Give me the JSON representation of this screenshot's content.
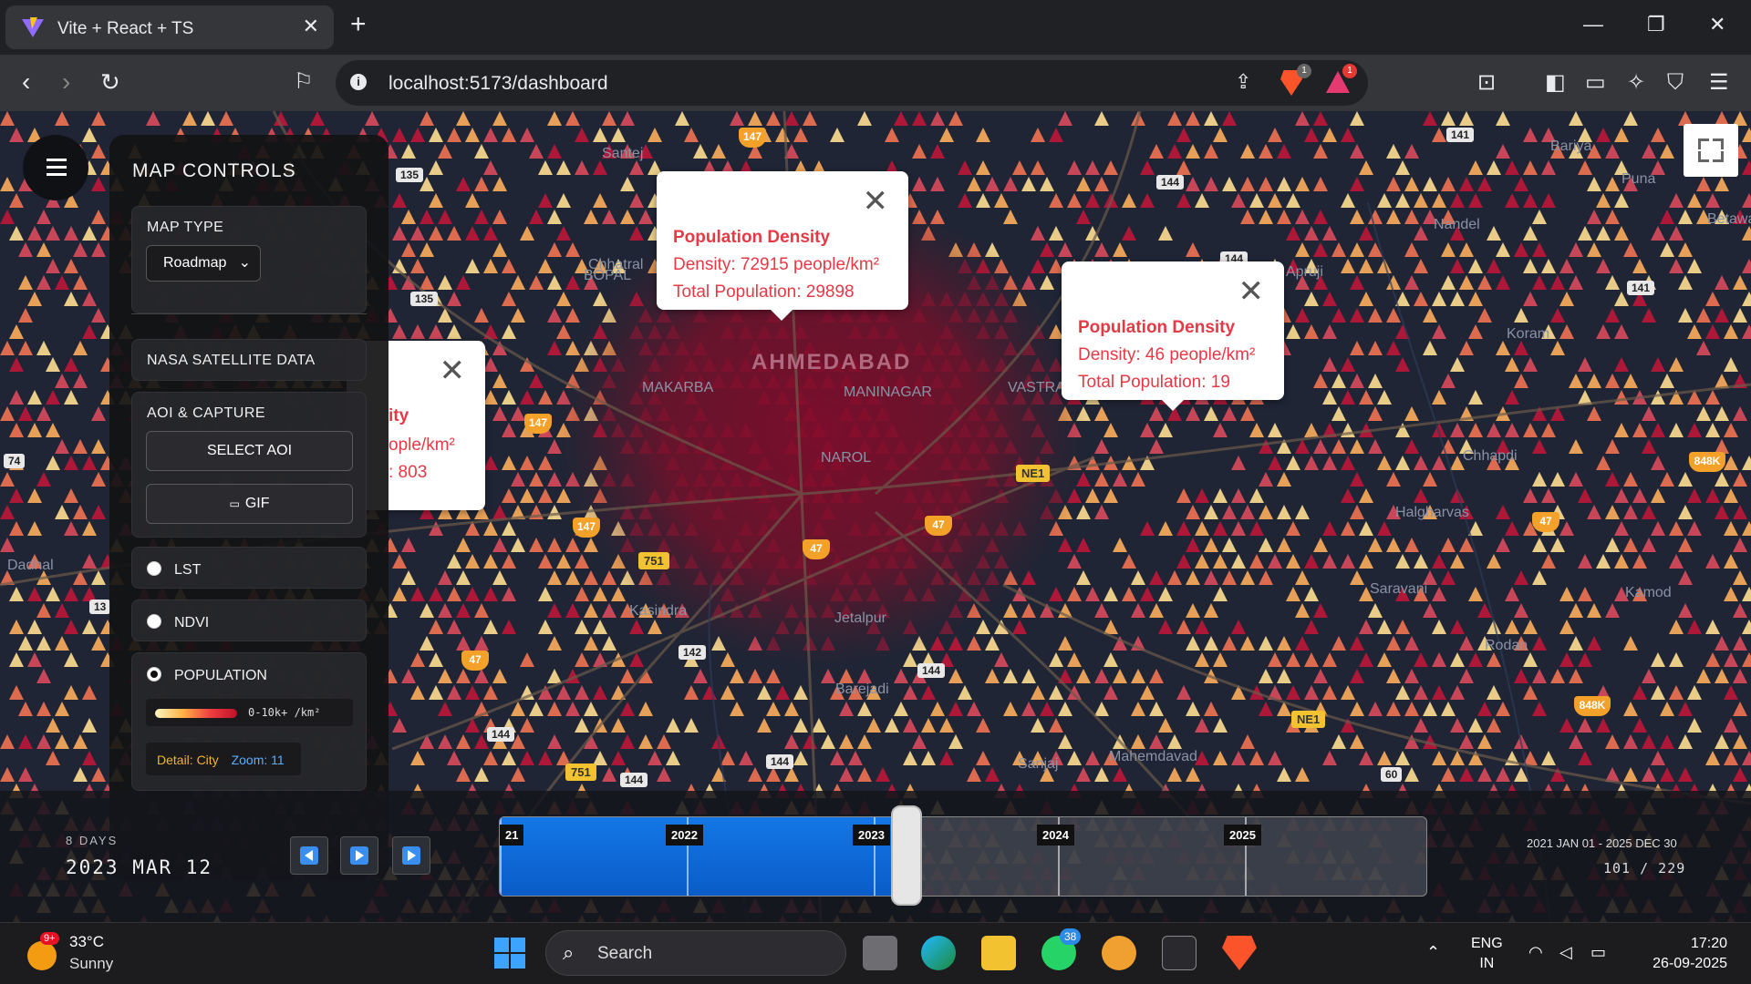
{
  "browser": {
    "tab_title": "Vite + React + TS",
    "url": "localhost:5173/dashboard",
    "brave_badge": "1",
    "rewards_badge": "1"
  },
  "map": {
    "place_labels": [
      "Santej",
      "Chhatral",
      "BOPAL",
      "MAKARBA",
      "MANINAGAR",
      "NAROL",
      "VASTRAL",
      "Apruji",
      "Koram",
      "Chhapdi",
      "Halgharvas",
      "Saravani",
      "Kamod",
      "Rodan",
      "Kasindra",
      "Jetalpur",
      "Barejadi",
      "Mahemdavad",
      "Sanjaj",
      "Bariya",
      "Puna",
      "Betawad",
      "Nandel",
      "Dadhal"
    ],
    "route_badges": [
      "135",
      "135",
      "144",
      "144",
      "141",
      "141",
      "142",
      "144",
      "144",
      "144",
      "144",
      "13",
      "74",
      "60"
    ],
    "yellow_routes": [
      "NE1",
      "NE1",
      "751",
      "751"
    ],
    "shields": [
      "147",
      "147",
      "47",
      "47",
      "47",
      "47",
      "147",
      "848K",
      "848K"
    ],
    "city_label": "AHMEDABAD"
  },
  "popups": [
    {
      "title": "Population Density",
      "density": "Density: 72915 people/km²",
      "total": "Total Population: 29898"
    },
    {
      "title": "Population Density",
      "density": "Density: 46 people/km²",
      "total": "Total Population: 19"
    },
    {
      "title_fragment": "ity",
      "density_fragment": "ople/km²",
      "total_fragment": ": 803"
    }
  ],
  "panel": {
    "title": "MAP CONTROLS",
    "map_type_label": "MAP TYPE",
    "map_type_value": "Roadmap",
    "nasa_label": "NASA SATELLITE DATA",
    "aoi_label": "AOI & CAPTURE",
    "select_aoi": "SELECT AOI",
    "gif": "GIF",
    "layers": [
      {
        "label": "LST",
        "selected": false
      },
      {
        "label": "NDVI",
        "selected": false
      },
      {
        "label": "POPULATION",
        "selected": true
      }
    ],
    "legend_text": "0-10k+ /km²",
    "detail_label": "Detail: City",
    "zoom_label": "Zoom: 11"
  },
  "timeline": {
    "days": "8 DAYS",
    "date": "2023 MAR 12",
    "years": [
      "2021",
      "2022",
      "2023",
      "2024",
      "2025"
    ],
    "year_tags": [
      "21",
      "2022",
      "2023",
      "2024",
      "2025"
    ],
    "range": "2021 JAN 01 - 2025 DEC 30",
    "count": "101 / 229",
    "progress": 0.44
  },
  "taskbar": {
    "weather_badge": "9+",
    "temperature": "33°C",
    "condition": "Sunny",
    "search": "Search",
    "whatsapp_badge": "38",
    "lang_top": "ENG",
    "lang_bottom": "IN",
    "time": "17:20",
    "date": "26-09-2025"
  },
  "colors": {
    "accent": "#e63946",
    "timeline_fill": "#1477e6",
    "brave": "#fb542b"
  }
}
